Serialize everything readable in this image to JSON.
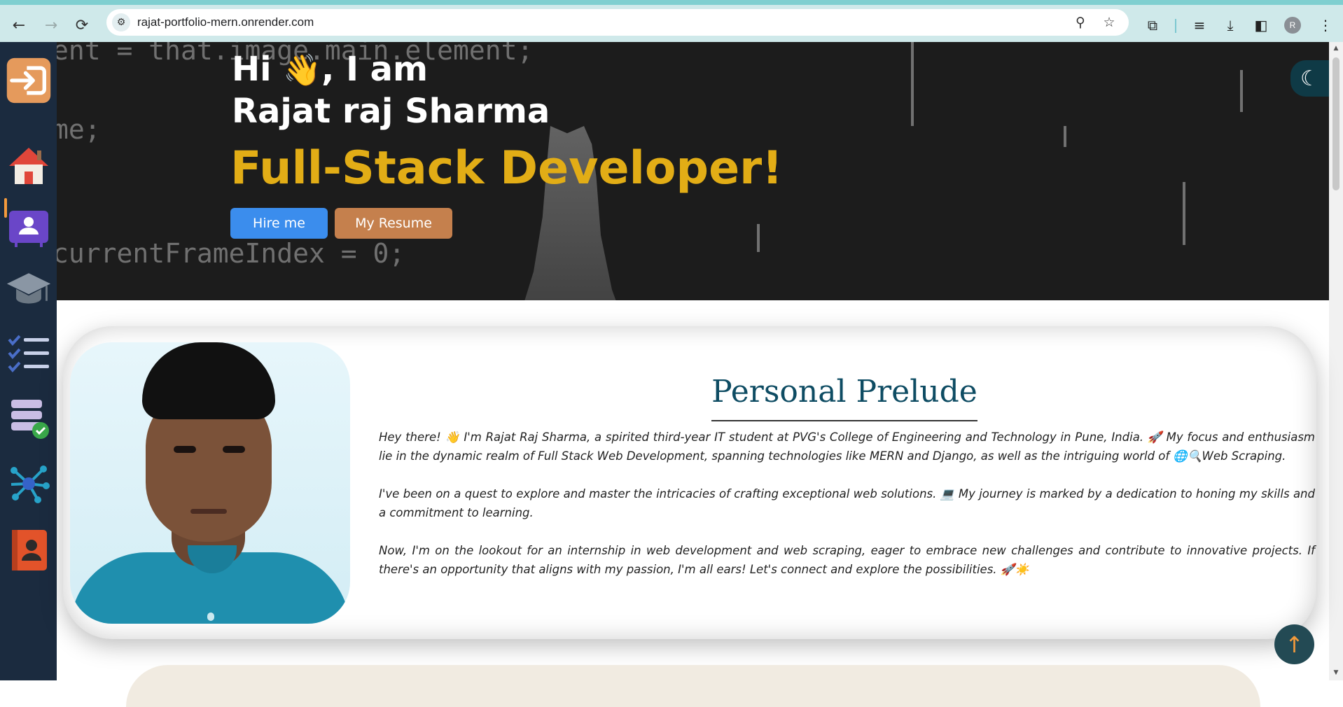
{
  "browser": {
    "url": "rajat-portfolio-mern.onrender.com",
    "back_icon": "←",
    "forward_icon": "→",
    "reload_icon": "⟳",
    "site_info_icon": "⚙",
    "zoom_icon": "⚲",
    "star_icon": "☆",
    "extensions_icon": "⧉",
    "media_icon": "≡",
    "download_icon": "⤓",
    "sidepanel_icon": "◧",
    "profile_initial": "R",
    "menu_icon": "⋮"
  },
  "sidebar": {
    "items": [
      {
        "name": "login",
        "icon": "login-arrow-icon"
      },
      {
        "name": "home",
        "icon": "home-icon"
      },
      {
        "name": "about",
        "icon": "profile-card-icon"
      },
      {
        "name": "education",
        "icon": "graduation-cap-icon"
      },
      {
        "name": "skills",
        "icon": "checklist-icon"
      },
      {
        "name": "projects",
        "icon": "database-check-icon"
      },
      {
        "name": "network",
        "icon": "network-hub-icon"
      },
      {
        "name": "contact",
        "icon": "contact-book-icon"
      }
    ]
  },
  "hero": {
    "greeting_prefix": "Hi",
    "wave_emoji": "👋",
    "greeting_suffix": ", I am",
    "name": "Rajat raj Sharma",
    "role": "Full-Stack Developer!",
    "hire_button": "Hire me",
    "resume_button": "My Resume",
    "code_line_1": "ent = that.image.main.element;",
    "code_line_2": "me;",
    "code_line_3": "currentFrameIndex = 0;",
    "theme_toggle_icon": "☾"
  },
  "about": {
    "title": "Personal Prelude",
    "paragraphs": [
      "Hey there! 👋 I'm Rajat Raj Sharma, a spirited third-year IT student at PVG's College of Engineering and Technology in Pune, India. 🚀 My focus and enthusiasm lie in the dynamic realm of Full Stack Web Development, spanning technologies like MERN and Django, as well as the intriguing world of 🌐🔍Web Scraping.",
      "I've been on a quest to explore and master the intricacies of crafting exceptional web solutions. 💻 My journey is marked by a dedication to honing my skills and a commitment to learning.",
      "Now, I'm on the lookout for an internship in web development and web scraping, eager to embrace new challenges and contribute to innovative projects. If there's an opportunity that aligns with my passion, I'm all ears! Let's connect and explore the possibilities. 🚀☀️"
    ]
  },
  "scroll_top_icon": "↑",
  "colors": {
    "sidebar_bg": "#1b2b3f",
    "hero_bg": "#1c1c1c",
    "role_color": "#e2ad16",
    "hire_button": "#3b8ded",
    "resume_button": "#c5804d",
    "title_color": "#0e4c63",
    "chrome_bg": "#cfe9ea"
  }
}
